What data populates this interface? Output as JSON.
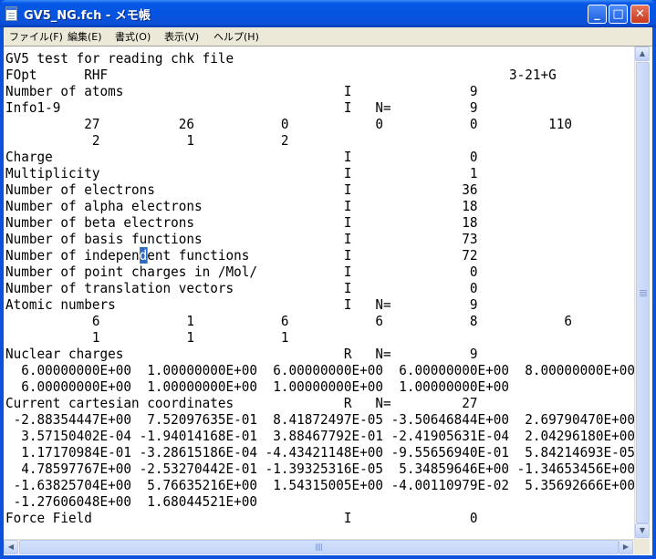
{
  "window": {
    "title": "GV5_NG.fch - メモ帳",
    "minimize": "_",
    "maximize": "□",
    "close": "✕"
  },
  "menu": [
    "ファイル(F)",
    "編集(E)",
    "書式(O)",
    "表示(V)",
    "ヘルプ(H)"
  ],
  "scroll": {
    "up": "▲",
    "down": "▼",
    "left": "◀",
    "right": "▶"
  },
  "lines": [
    "GV5 test for reading chk file",
    "FOpt      RHF                                                   3-21+G",
    "Number of atoms                            I               9",
    "Info1-9                                    I   N=          9",
    "          27          26           0           0           0         110",
    "           2           1           2",
    "Charge                                     I               0",
    "Multiplicity                               I               1",
    "Number of electrons                        I              36",
    "Number of alpha electrons                  I              18",
    "Number of beta electrons                   I              18",
    "Number of basis functions                  I              73",
    "Number of independent functions            I              72",
    "Number of point charges in /Mol/           I               0",
    "Number of translation vectors              I               0",
    "Atomic numbers                             I   N=          9",
    "           6           1           6           6           8           6",
    "           1           1           1",
    "Nuclear charges                            R   N=          9",
    "  6.00000000E+00  1.00000000E+00  6.00000000E+00  6.00000000E+00  8.00000000E+00",
    "  6.00000000E+00  1.00000000E+00  1.00000000E+00  1.00000000E+00",
    "Current cartesian coordinates              R   N=         27",
    " -2.88354447E+00  7.52097635E-01  8.41872497E-05 -3.50646844E+00  2.69790470E+00",
    "  3.57150402E-04 -1.94014168E-01  3.88467792E-01 -2.41905631E-04  2.04296180E+00",
    "  1.17170984E-01 -3.28615186E-04 -4.43421148E+00 -9.55656940E-01  5.84214693E-05",
    "  4.78597767E+00 -2.53270442E-01 -1.39325316E-05  5.34859646E+00 -1.34653456E+00",
    " -1.63825704E+00  5.76635216E+00  1.54315005E+00 -4.00110979E-02  5.35692666E+00",
    " -1.27606048E+00  1.68044521E+00",
    "Force Field                                I               0"
  ],
  "selection": {
    "line": 12,
    "before": "Number of indepen",
    "selected": "d",
    "after": "ent functions            I              72"
  }
}
